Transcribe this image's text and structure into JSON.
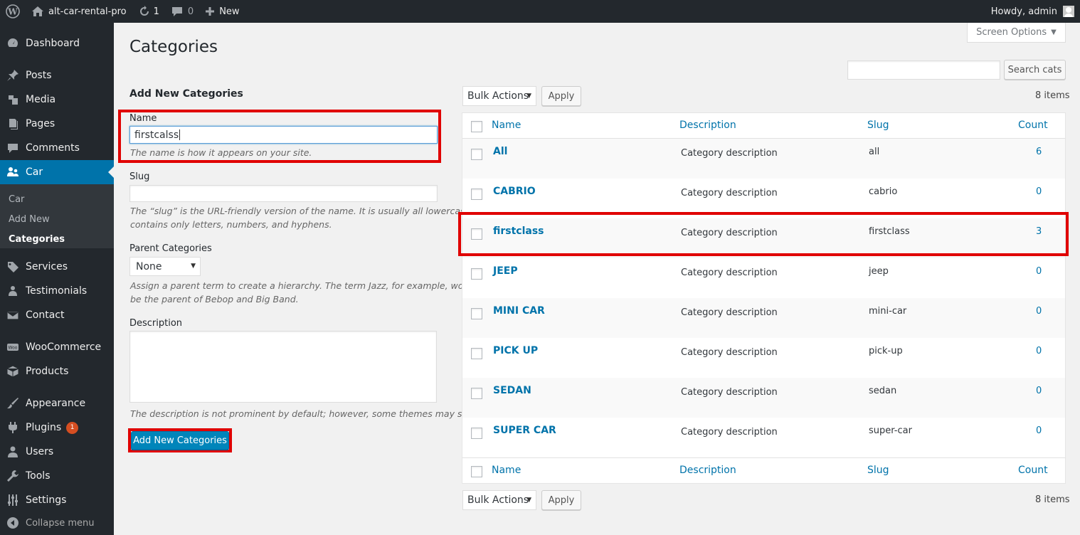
{
  "admin_bar": {
    "site_name": "alt-car-rental-pro",
    "updates_count": "1",
    "comments_count": "0",
    "new_label": "New",
    "greeting": "Howdy, admin"
  },
  "sidebar": {
    "items": [
      {
        "label": "Dashboard",
        "icon": "dashboard-icon"
      },
      {
        "label": "Posts",
        "icon": "pushpin-icon"
      },
      {
        "label": "Media",
        "icon": "media-icon"
      },
      {
        "label": "Pages",
        "icon": "pages-icon"
      },
      {
        "label": "Comments",
        "icon": "comment-icon"
      },
      {
        "label": "Car",
        "icon": "car-people-icon"
      },
      {
        "label": "Services",
        "icon": "tag-icon"
      },
      {
        "label": "Testimonials",
        "icon": "people-icon"
      },
      {
        "label": "Contact",
        "icon": "envelope-icon"
      },
      {
        "label": "WooCommerce",
        "icon": "woo-icon"
      },
      {
        "label": "Products",
        "icon": "box-icon"
      },
      {
        "label": "Appearance",
        "icon": "brush-icon"
      },
      {
        "label": "Plugins",
        "icon": "plug-icon",
        "badge": "1"
      },
      {
        "label": "Users",
        "icon": "user-icon"
      },
      {
        "label": "Tools",
        "icon": "wrench-icon"
      },
      {
        "label": "Settings",
        "icon": "sliders-icon"
      }
    ],
    "submenu": [
      "Car",
      "Add New",
      "Categories"
    ],
    "collapse_label": "Collapse menu"
  },
  "page": {
    "title": "Categories",
    "screen_options": "Screen Options",
    "search_button": "Search cats"
  },
  "form": {
    "heading": "Add New Categories",
    "name_label": "Name",
    "name_value": "firstcalss",
    "name_help": "The name is how it appears on your site.",
    "slug_label": "Slug",
    "slug_value": "",
    "slug_help_1": "The “slug” is the URL-friendly version of the name. It is usually all lowercase and",
    "slug_help_2": "contains only letters, numbers, and hyphens.",
    "parent_label": "Parent Categories",
    "parent_value": "None",
    "parent_help_1": "Assign a parent term to create a hierarchy. The term Jazz, for example, would",
    "parent_help_2": "be the parent of Bebop and Big Band.",
    "description_label": "Description",
    "description_help": "The description is not prominent by default; however, some themes may show it.",
    "submit_label": "Add New Categories"
  },
  "table": {
    "bulk_actions": "Bulk Actions",
    "apply": "Apply",
    "items_count": "8 items",
    "headers": {
      "name": "Name",
      "description": "Description",
      "slug": "Slug",
      "count": "Count"
    },
    "rows": [
      {
        "name": "All",
        "description": "Category description",
        "slug": "all",
        "count": "6"
      },
      {
        "name": "CABRIO",
        "description": "Category description",
        "slug": "cabrio",
        "count": "0"
      },
      {
        "name": "firstclass",
        "description": "Category description",
        "slug": "firstclass",
        "count": "3"
      },
      {
        "name": "JEEP",
        "description": "Category description",
        "slug": "jeep",
        "count": "0"
      },
      {
        "name": "MINI CAR",
        "description": "Category description",
        "slug": "mini-car",
        "count": "0"
      },
      {
        "name": "PICK UP",
        "description": "Category description",
        "slug": "pick-up",
        "count": "0"
      },
      {
        "name": "SEDAN",
        "description": "Category description",
        "slug": "sedan",
        "count": "0"
      },
      {
        "name": "SUPER CAR",
        "description": "Category description",
        "slug": "super-car",
        "count": "0"
      }
    ]
  },
  "colors": {
    "accent": "#0073aa",
    "highlight": "#e00000",
    "sidebar": "#23282d"
  }
}
